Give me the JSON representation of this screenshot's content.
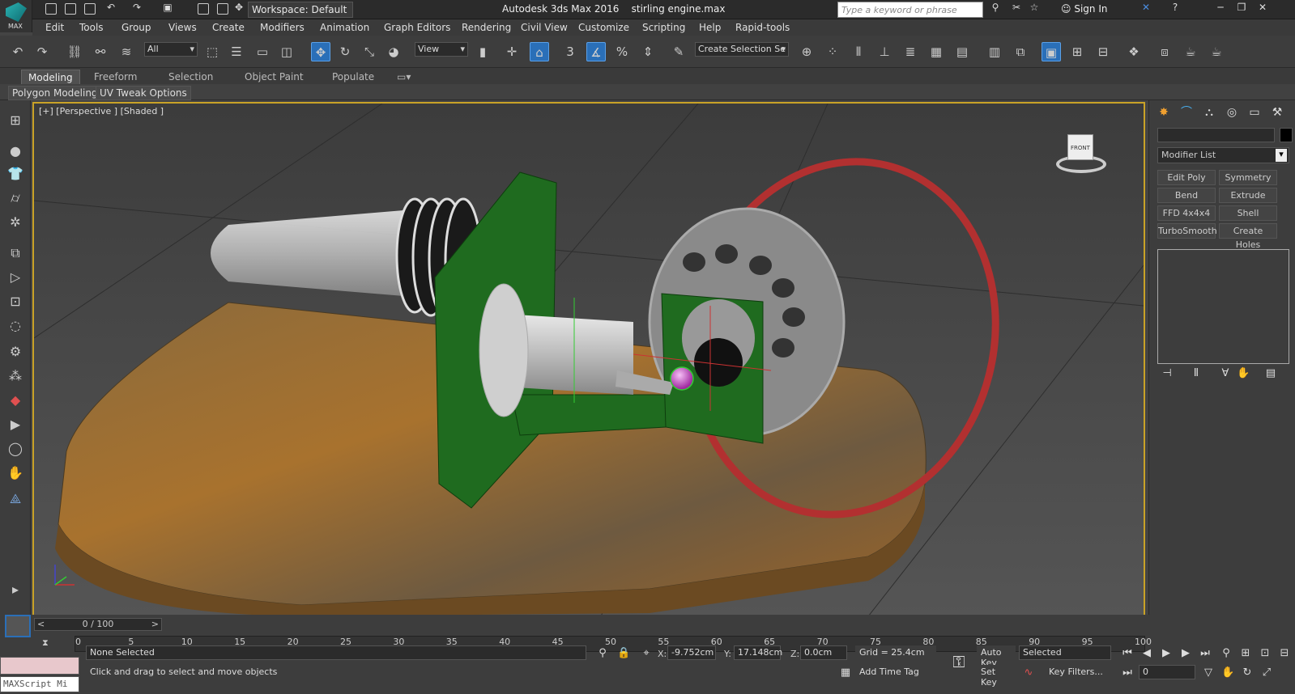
{
  "app": {
    "logo_text": "MAX",
    "title": "Autodesk 3ds Max 2016",
    "file": "stirling engine.max"
  },
  "titlebar": {
    "workspace": "Workspace: Default",
    "search_placeholder": "Type a keyword or phrase",
    "signin": "Sign In"
  },
  "menu": [
    "Edit",
    "Tools",
    "Group",
    "Views",
    "Create",
    "Modifiers",
    "Animation",
    "Graph Editors",
    "Rendering",
    "Civil View",
    "Customize",
    "Scripting",
    "Help",
    "Rapid-tools"
  ],
  "toolbar": {
    "filter": "All",
    "refcoord": "View",
    "selset": "Create Selection Se"
  },
  "ribbon": {
    "tabs": [
      "Modeling",
      "Freeform",
      "Selection",
      "Object Paint",
      "Populate"
    ],
    "active": "Modeling",
    "sub": [
      "Polygon Modeling",
      "UV Tweak Options"
    ]
  },
  "viewport": {
    "label": "[+] [Perspective ] [Shaded ]",
    "viewcube_face": "FRONT"
  },
  "command_panel": {
    "modifier_list": "Modifier List",
    "buttons": [
      "Edit Poly",
      "Symmetry",
      "Bend",
      "Extrude",
      "FFD 4x4x4",
      "Shell",
      "TurboSmooth",
      "Create Holes"
    ]
  },
  "timeline": {
    "frame": "0 / 100",
    "ticks": [
      "0",
      "5",
      "10",
      "15",
      "20",
      "25",
      "30",
      "35",
      "40",
      "45",
      "50",
      "55",
      "60",
      "65",
      "70",
      "75",
      "80",
      "85",
      "90",
      "95",
      "100"
    ]
  },
  "status": {
    "selection": "None Selected",
    "prompt": "Click and drag to select and move objects",
    "x": "-9.752cm",
    "y": "17.148cm",
    "z": "0.0cm",
    "x_label": "X:",
    "y_label": "Y:",
    "z_label": "Z:",
    "grid": "Grid = 25.4cm",
    "add_time_tag": "Add Time Tag",
    "auto_key": "Auto Key",
    "set_key": "Set Key",
    "key_mode": "Selected",
    "key_filters": "Key Filters...",
    "current_frame": "0",
    "maxscript": "MAXScript Mi"
  },
  "colors": {
    "accent": "#2a6fb8",
    "viewport_border": "#c9a227"
  }
}
